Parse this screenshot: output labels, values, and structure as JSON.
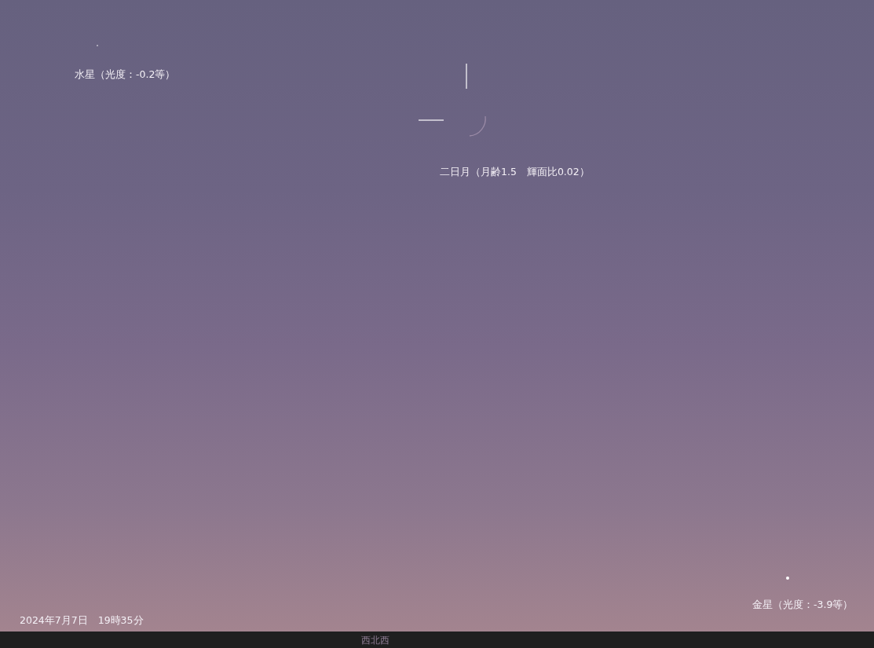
{
  "sky": {
    "objects": [
      {
        "kind": "planet",
        "label": "水星（光度：-0.2等）"
      },
      {
        "kind": "moon",
        "label": "二日月（月齢1.5　輝面比0.02）"
      },
      {
        "kind": "planet",
        "label": "金星（光度：-3.9等）"
      }
    ],
    "datetime": "2024年7月7日　19時35分"
  },
  "horizon_bar": {
    "direction": "西北西"
  }
}
